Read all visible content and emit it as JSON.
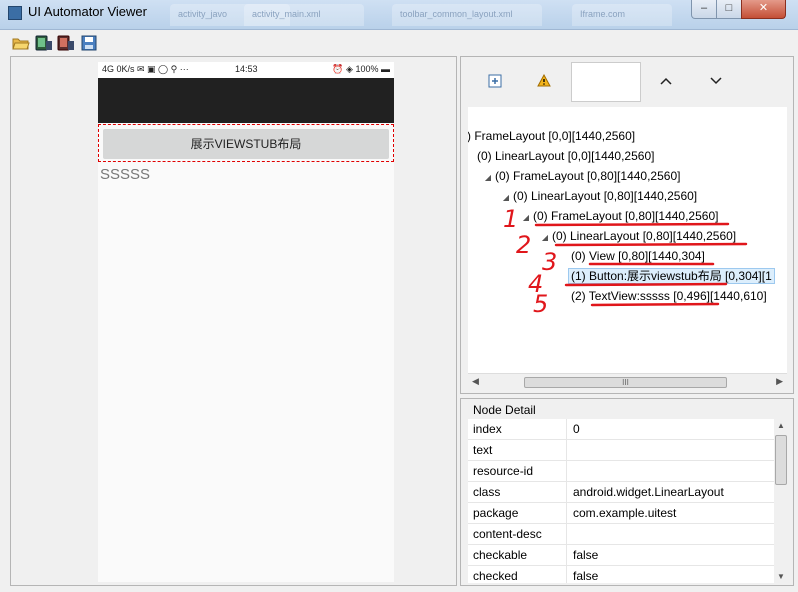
{
  "window": {
    "title": "UI Automator Viewer",
    "background_tabs": [
      "activity_javo",
      "activity_main.xml",
      "toolbar_common_layout.xml",
      "Iframe.com"
    ]
  },
  "toolbar": {
    "icons": [
      "open-folder-icon",
      "device-screenshot-icon",
      "device-screenshot-compressed-icon",
      "save-icon"
    ]
  },
  "device": {
    "status_left": "4G 0K/s ✉ ▣ ◯ ⚲ ···",
    "status_time": "14:53",
    "status_right": "⏰ ◈ 100% ▬",
    "button_label": "展示VIEWSTUB布局",
    "text_label": "SSSSS"
  },
  "hierarchy": {
    "tools": [
      "expand-all-icon",
      "warning-icon",
      "chevron-up-icon",
      "chevron-down-icon"
    ],
    "rows": [
      {
        "label": ") FrameLayout [0,0][1440,2560]",
        "level": 0,
        "arrow": ""
      },
      {
        "label": "(0) LinearLayout [0,0][1440,2560]",
        "level": 1,
        "arrow": ""
      },
      {
        "label": "(0) FrameLayout [0,80][1440,2560]",
        "level": 2,
        "arrow": "◢"
      },
      {
        "label": "(0) LinearLayout [0,80][1440,2560]",
        "level": 3,
        "arrow": "◢"
      },
      {
        "label": "(0) FrameLayout [0,80][1440,2560]",
        "level": 4,
        "arrow": "◢"
      },
      {
        "label": "(0) LinearLayout [0,80][1440,2560]",
        "level": 5,
        "arrow": "◢"
      },
      {
        "label": "(0) View [0,80][1440,304]",
        "level": 6,
        "arrow": ""
      },
      {
        "label": "(1) Button:展示viewstub布局 [0,304][1",
        "level": 6,
        "arrow": "",
        "selected": true
      },
      {
        "label": "(2) TextView:sssss [0,496][1440,610]",
        "level": 6,
        "arrow": ""
      }
    ],
    "scroll_thumb": "III"
  },
  "node_detail": {
    "title": "Node Detail",
    "rows": [
      {
        "key": "index",
        "value": "0"
      },
      {
        "key": "text",
        "value": ""
      },
      {
        "key": "resource-id",
        "value": ""
      },
      {
        "key": "class",
        "value": "android.widget.LinearLayout"
      },
      {
        "key": "package",
        "value": "com.example.uitest"
      },
      {
        "key": "content-desc",
        "value": ""
      },
      {
        "key": "checkable",
        "value": "false"
      },
      {
        "key": "checked",
        "value": "false"
      }
    ]
  },
  "annotations": [
    "1",
    "2",
    "3",
    "4",
    "5"
  ],
  "colors": {
    "annotation": "#e0161b",
    "selection": "#dceefc",
    "action_bar": "#212121"
  }
}
